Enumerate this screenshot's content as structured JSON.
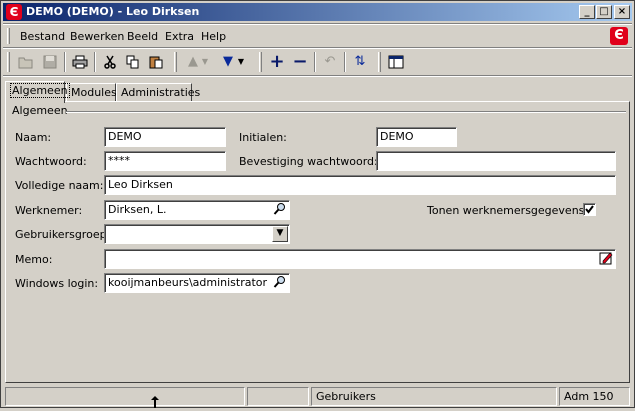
{
  "window": {
    "title": "DEMO (DEMO) - Leo Dirksen",
    "app_icon": "Є"
  },
  "menu": [
    {
      "label": "Bestand"
    },
    {
      "label": "Bewerken"
    },
    {
      "label": "Beeld"
    },
    {
      "label": "Extra"
    },
    {
      "label": "Help"
    }
  ],
  "toolbar": {
    "icons": [
      "open-folder-icon",
      "save-icon",
      "print-icon",
      "cut-icon",
      "copy-icon",
      "paste-icon",
      "arrow-up-icon",
      "arrow-down-icon",
      "add-icon",
      "remove-icon",
      "undo-icon",
      "refresh-icon",
      "window-icon"
    ]
  },
  "tabs": [
    {
      "label": "Algemeen",
      "active": true
    },
    {
      "label": "Modules"
    },
    {
      "label": "Administraties"
    }
  ],
  "group": {
    "title": "Algemeen"
  },
  "form": {
    "naam_label": "Naam:",
    "naam_value": "DEMO",
    "initialen_label": "Initialen:",
    "initialen_value": "DEMO",
    "wachtwoord_label": "Wachtwoord:",
    "wachtwoord_value": "****",
    "bevestiging_label": "Bevestiging wachtwoord:",
    "bevestiging_value": "",
    "volledige_naam_label": "Volledige naam:",
    "volledige_naam_value": "Leo Dirksen",
    "werknemer_label": "Werknemer:",
    "werknemer_value": "Dirksen, L.",
    "tonen_label": "Tonen werknemersgegevens:",
    "tonen_checked": true,
    "gebruikersgroep_label": "Gebruikersgroep:",
    "gebruikersgroep_value": "",
    "memo_label": "Memo:",
    "memo_value": "",
    "windows_login_label": "Windows login:",
    "windows_login_value": "kooijmanbeurs\\administrator"
  },
  "status": {
    "cell1": "",
    "cell2": "",
    "cell3": "Gebruikers",
    "cell4": "Adm 150"
  },
  "colors": {
    "brand": "#e0001b",
    "title_start": "#0a246a",
    "title_end": "#a6caf0",
    "face": "#d4d0c8"
  }
}
